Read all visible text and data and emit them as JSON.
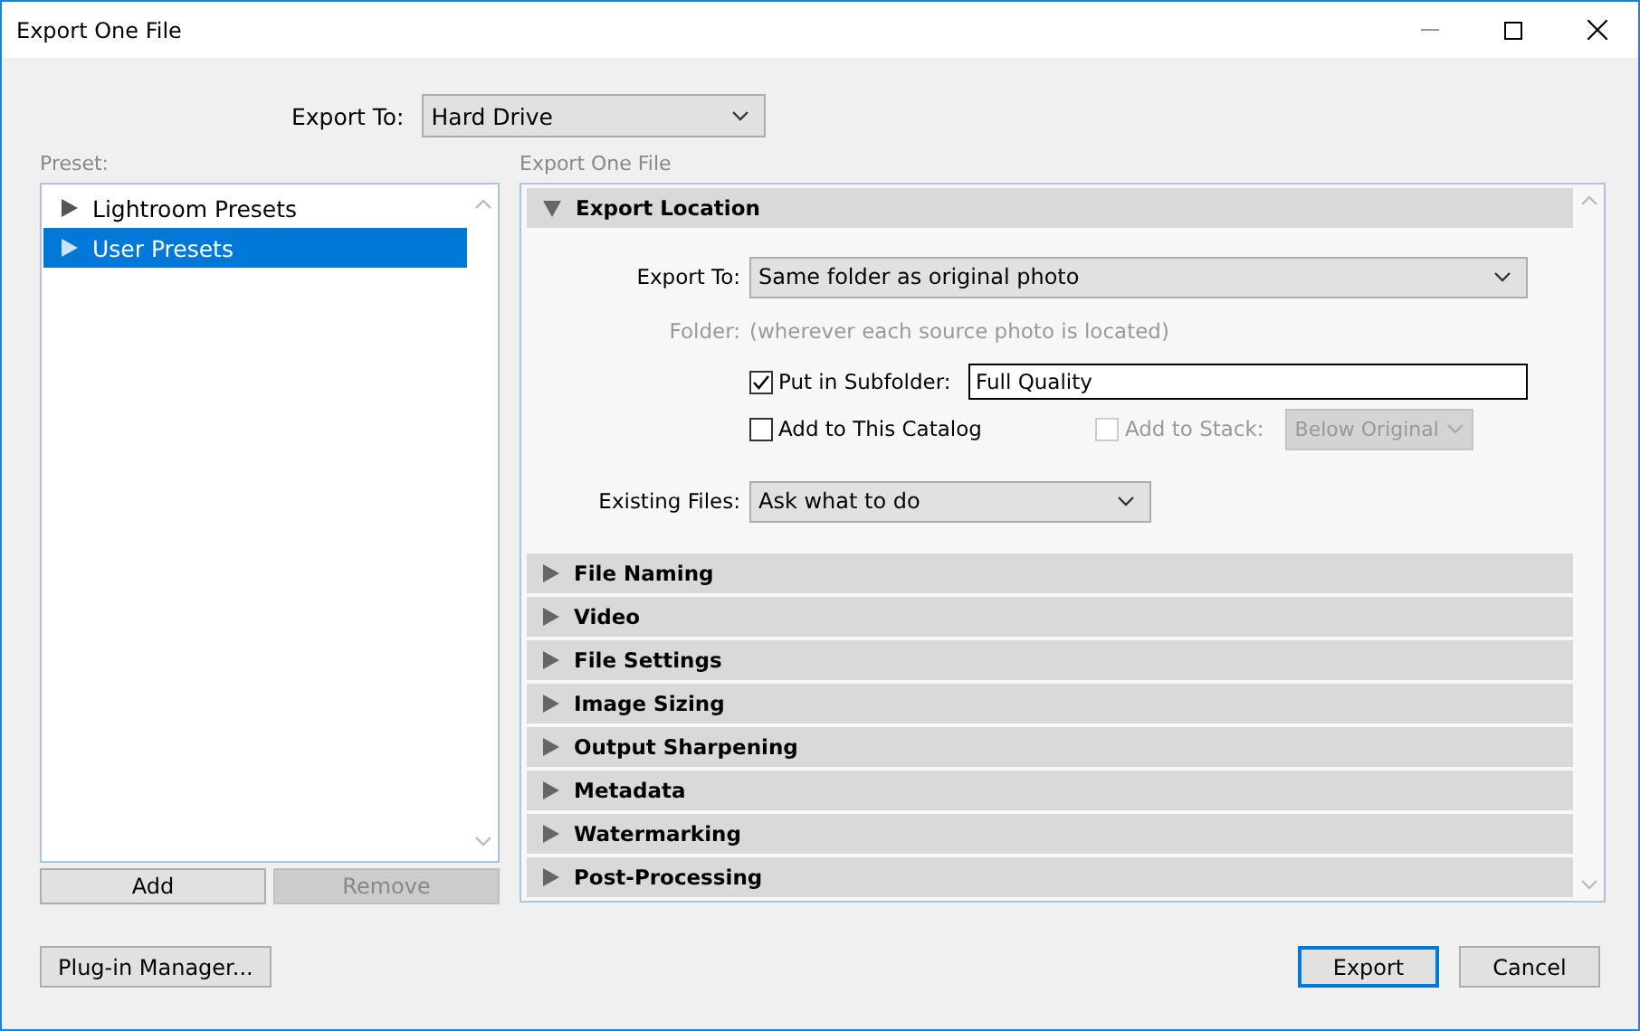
{
  "window": {
    "title": "Export One File"
  },
  "export_to": {
    "label": "Export To:",
    "value": "Hard Drive"
  },
  "preset": {
    "label": "Preset:",
    "items": [
      {
        "label": "Lightroom Presets",
        "expanded": false,
        "selected": false
      },
      {
        "label": "User Presets",
        "expanded": false,
        "selected": true
      }
    ],
    "buttons": [
      {
        "label": "Add",
        "disabled": false
      },
      {
        "label": "Remove",
        "disabled": true
      }
    ]
  },
  "export_panel": {
    "label": "Export One File",
    "sections": [
      {
        "title": "Export Location",
        "expanded": true,
        "fields": {
          "export_to": {
            "label": "Export To:",
            "value": "Same folder as original photo"
          },
          "folder": {
            "label": "Folder:",
            "value": "(wherever each source photo is located)",
            "disabled": true
          },
          "put_in_subfolder": {
            "label": "Put in Subfolder:",
            "checked": true,
            "value": "Full Quality"
          },
          "add_to_catalog": {
            "label": "Add to This Catalog",
            "checked": false
          },
          "add_to_stack": {
            "label": "Add to Stack:",
            "checked": false,
            "disabled": true,
            "value": "Below Original"
          },
          "existing_files": {
            "label": "Existing Files:",
            "value": "Ask what to do"
          }
        }
      },
      {
        "title": "File Naming",
        "expanded": false
      },
      {
        "title": "Video",
        "expanded": false
      },
      {
        "title": "File Settings",
        "expanded": false
      },
      {
        "title": "Image Sizing",
        "expanded": false
      },
      {
        "title": "Output Sharpening",
        "expanded": false
      },
      {
        "title": "Metadata",
        "expanded": false
      },
      {
        "title": "Watermarking",
        "expanded": false
      },
      {
        "title": "Post-Processing",
        "expanded": false
      }
    ]
  },
  "footer": {
    "buttons": [
      {
        "label": "Plug-in Manager...",
        "default": false
      },
      {
        "label": "Export",
        "default": true
      },
      {
        "label": "Cancel",
        "default": false
      }
    ]
  }
}
